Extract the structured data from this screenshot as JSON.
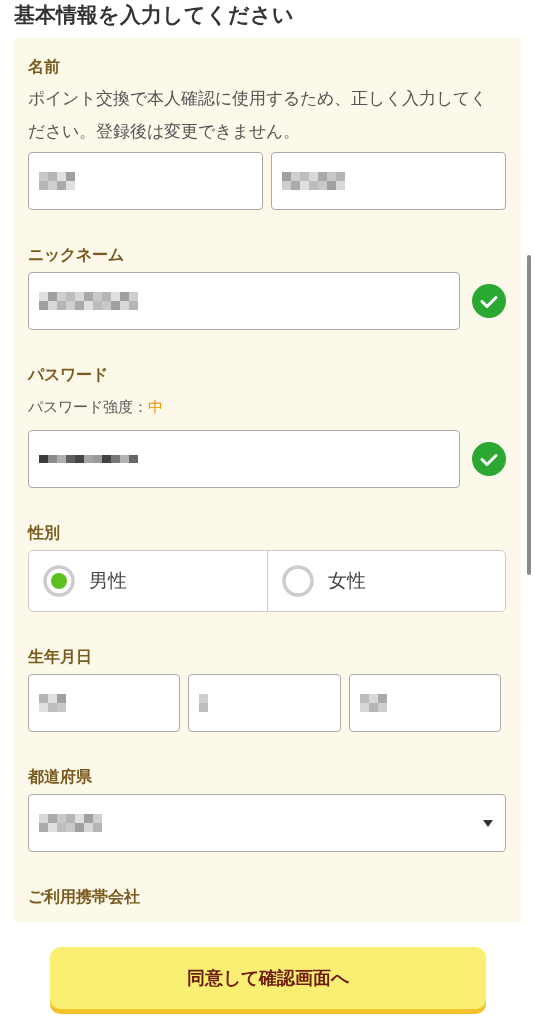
{
  "title": "基本情報を入力してください",
  "sections": [
    {
      "kind": "text_pair",
      "label": "名前",
      "note": "ポイント交換で本人確認に使用するため、正しく入力してください。登録後は変更できません。"
    },
    {
      "kind": "text",
      "label": "ニックネーム",
      "valid": true
    },
    {
      "kind": "password",
      "label": "パスワード",
      "strength_label": "パスワード強度：",
      "strength": "中",
      "valid": true
    },
    {
      "kind": "radio",
      "label": "性別",
      "options": [
        {
          "label": "男性",
          "selected": true
        },
        {
          "label": "女性",
          "selected": false
        }
      ]
    },
    {
      "kind": "date",
      "label": "生年月日"
    },
    {
      "kind": "select",
      "label": "都道府県"
    },
    {
      "kind": "label_only",
      "label": "ご利用携帯会社"
    }
  ],
  "submit": "同意して確認画面へ"
}
